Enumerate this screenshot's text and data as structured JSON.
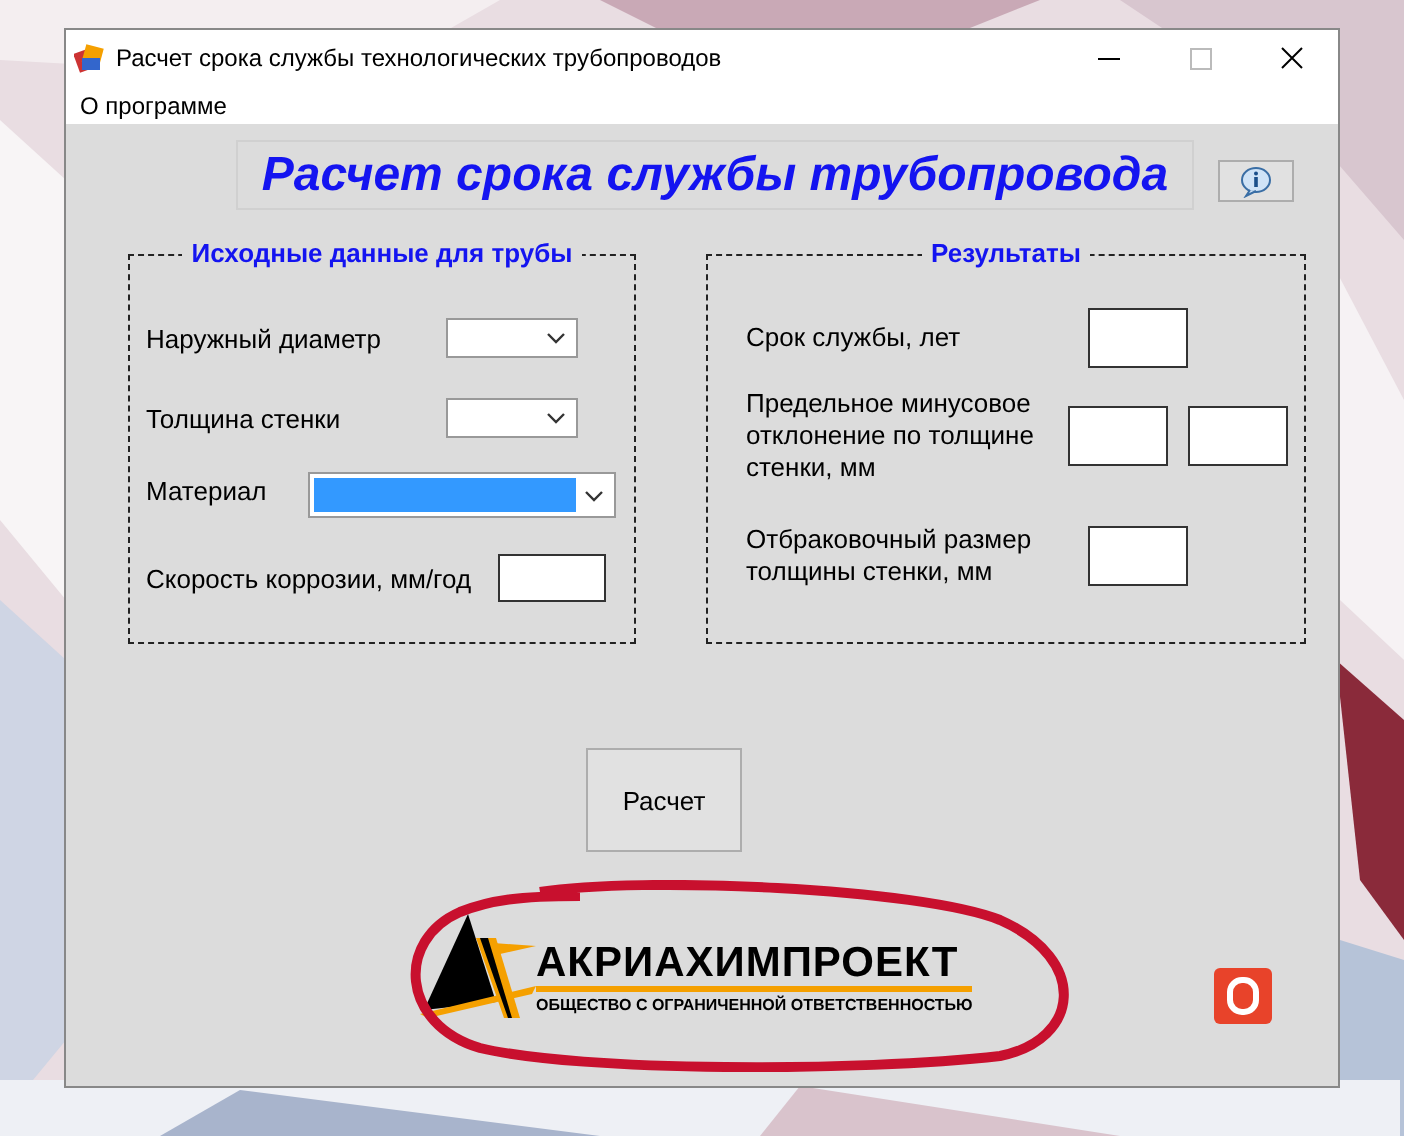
{
  "window": {
    "title": "Расчет срока службы технологических трубопроводов"
  },
  "menu": [
    {
      "label": "О программе"
    }
  ],
  "header": {
    "title": "Расчет срока службы трубопровода"
  },
  "input_group": {
    "legend": "Исходные данные для трубы",
    "fields": [
      {
        "label": "Наружный диаметр",
        "kind": "combo",
        "focused": false
      },
      {
        "label": "Толщина стенки",
        "kind": "combo",
        "focused": false
      },
      {
        "label": "Материал",
        "kind": "wide-combo",
        "focused": true
      },
      {
        "label": "Скорость коррозии, мм/год",
        "kind": "text",
        "focused": false
      }
    ]
  },
  "results_group": {
    "legend": "Результаты",
    "fields": [
      {
        "label": "Срок службы, лет",
        "kind": "single"
      },
      {
        "label": "Предельное минусовое отклонение по толщине стенки, мм",
        "kind": "pair"
      },
      {
        "label": "Отбраковочный размер толщины стенки, мм",
        "kind": "single"
      }
    ]
  },
  "calc_button": {
    "label": "Расчет"
  },
  "logo": {
    "name": "АКРИАХИМПРОЕКТ",
    "subtitle": "ОБЩЕСТВО С ОГРАНИЧЕННОЙ ОТВЕТСТВЕННОСТЬЮ"
  }
}
